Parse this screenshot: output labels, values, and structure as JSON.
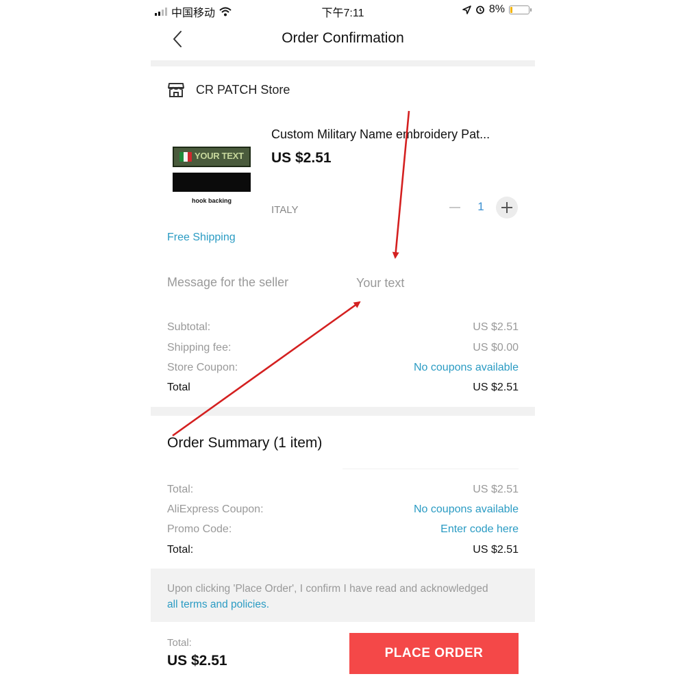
{
  "status_bar": {
    "carrier": "中国移动",
    "time": "下午7:11",
    "battery": "8%",
    "battery_level": 0.08
  },
  "header": {
    "title": "Order Confirmation"
  },
  "store": {
    "name": "CR PATCH Store"
  },
  "product": {
    "image_text": "YOUR TEXT",
    "image_caption": "hook backing",
    "name": "Custom Military Name embroidery Pat...",
    "price": "US $2.51",
    "variant": "ITALY",
    "quantity": "1",
    "shipping": "Free Shipping"
  },
  "message": {
    "label": "Message for the seller",
    "placeholder": "Your text"
  },
  "store_totals": {
    "subtotal_label": "Subtotal:",
    "subtotal_value": "US $2.51",
    "shipping_label": "Shipping fee:",
    "shipping_value": "US $0.00",
    "coupon_label": "Store Coupon:",
    "coupon_value": "No coupons available",
    "total_label": "Total",
    "total_value": "US $2.51"
  },
  "order_summary": {
    "title": "Order Summary (1 item)",
    "total_label": "Total:",
    "total_value": "US $2.51",
    "coupon_label": "AliExpress Coupon:",
    "coupon_value": "No coupons available",
    "promo_label": "Promo Code:",
    "promo_value": "Enter code here",
    "grand_total_label": "Total:",
    "grand_total_value": "US $2.51"
  },
  "terms": {
    "text": "Upon clicking 'Place Order', I confirm I have read and acknowledged",
    "link": "all terms and policies."
  },
  "footer": {
    "total_label": "Total:",
    "total_value": "US $2.51",
    "place_order": "PLACE ORDER"
  },
  "colors": {
    "accent": "#f44848",
    "link": "#2a9bc3",
    "annotation_arrow": "#d42020"
  }
}
